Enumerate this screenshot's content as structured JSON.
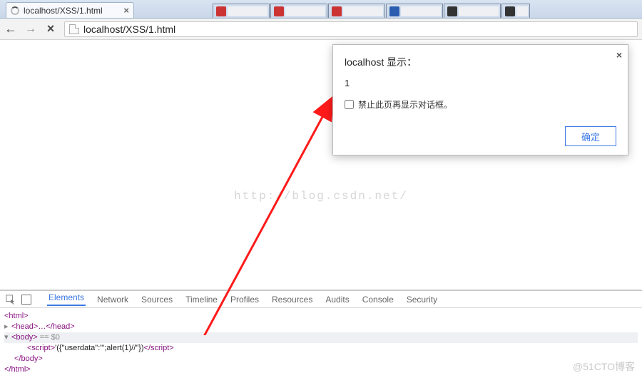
{
  "browser": {
    "tab_title": "localhost/XSS/1.html",
    "url": "localhost/XSS/1.html"
  },
  "dialog": {
    "title": "localhost 显示：",
    "message": "1",
    "suppress_label": "禁止此页再显示对话框。",
    "ok_label": "确定"
  },
  "watermark": "http://blog.csdn.net/",
  "footer_mark": "@51CTO博客",
  "devtools": {
    "tabs": {
      "elements": "Elements",
      "network": "Network",
      "sources": "Sources",
      "timeline": "Timeline",
      "profiles": "Profiles",
      "resources": "Resources",
      "audits": "Audits",
      "console": "Console",
      "security": "Security"
    },
    "dom": {
      "html_open": "<html>",
      "head_collapsed": "<head>…</head>",
      "body_open": "<body>",
      "body_sel": " == $0",
      "script_open": "<script>",
      "script_text": "'({\"userdata\":\"';alert(1)//\"})",
      "script_close": "</script>",
      "body_close": "</body>",
      "html_close": "</html>"
    }
  }
}
